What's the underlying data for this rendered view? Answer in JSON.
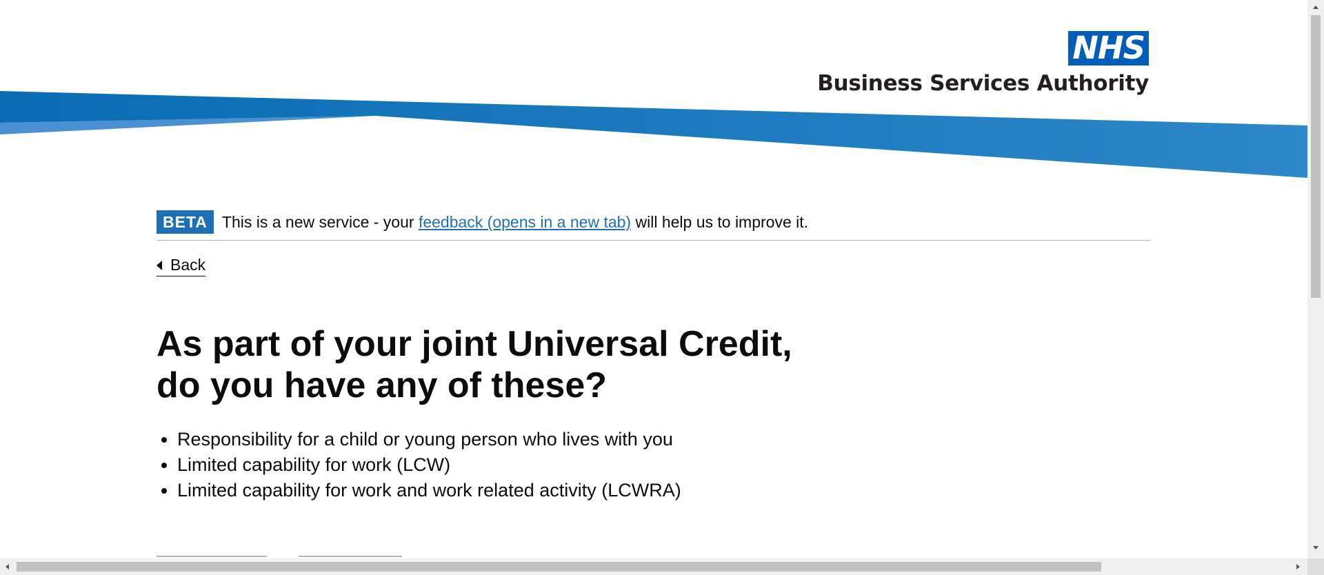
{
  "header": {
    "nhs_label": "NHS",
    "org_name": "Business Services Authority"
  },
  "phase_banner": {
    "tag": "BETA",
    "text_before": "This is a new service - your ",
    "link_text": "feedback (opens in a new tab)",
    "text_after": " will help us to improve it."
  },
  "back_link": "Back",
  "page_title": "As part of your joint Universal Credit, do you have any of these?",
  "conditions": [
    "Responsibility for a child or young person who lives with you",
    "Limited capability for work (LCW)",
    "Limited capability for work and work related activity (LCWRA)"
  ],
  "colors": {
    "brand_blue": "#005eb8",
    "link_blue": "#1d70b8",
    "swoosh_dark": "#0c6fb7",
    "swoosh_light": "#4a90d2"
  },
  "icons": {
    "back": "back-arrow-icon",
    "scroll_up": "scroll-up-icon",
    "scroll_down": "scroll-down-icon",
    "scroll_left": "scroll-left-icon",
    "scroll_right": "scroll-right-icon"
  }
}
